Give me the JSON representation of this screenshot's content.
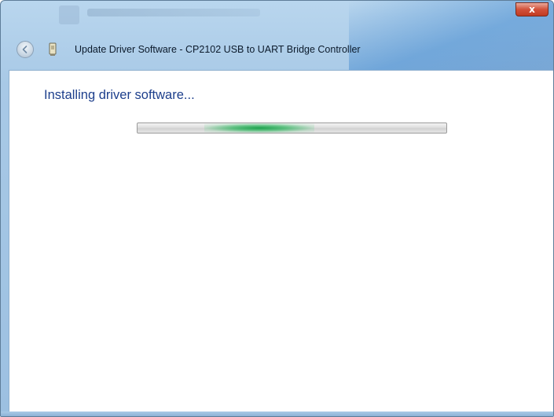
{
  "window": {
    "title": "Update Driver Software - CP2102 USB to UART Bridge Controller",
    "close_label": "x",
    "back_icon": "back-arrow-icon",
    "device_icon": "usb-device-icon"
  },
  "content": {
    "heading": "Installing driver software...",
    "progress_state": "indeterminate (marquee)"
  },
  "colors": {
    "heading": "#1d3f8c",
    "progress_glow": "#14a046",
    "close_button": "#d2513a"
  }
}
